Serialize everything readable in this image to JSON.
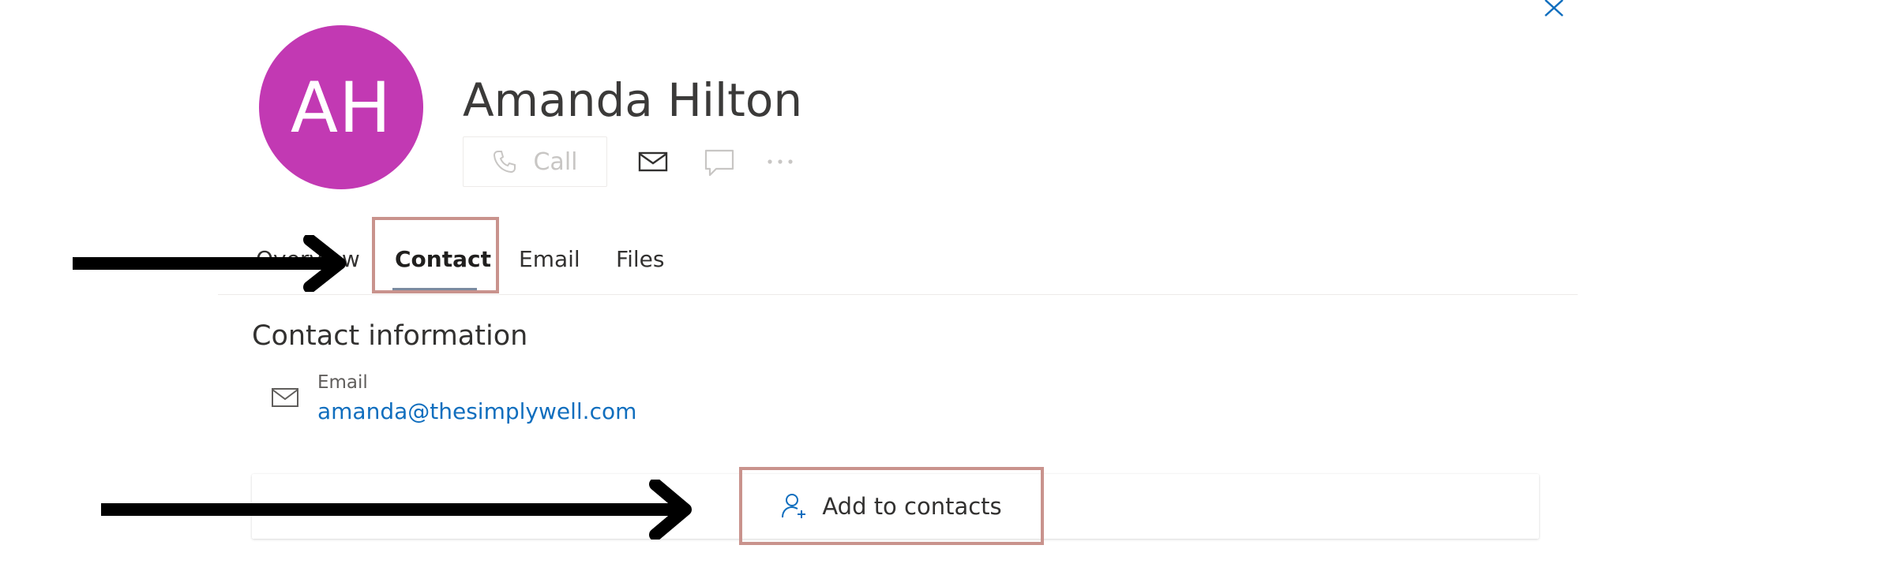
{
  "profile": {
    "initials": "AH",
    "name": "Amanda Hilton",
    "avatar_color": "#c239b3"
  },
  "actions": {
    "call_label": "Call",
    "call_icon": "phone-icon",
    "mail_icon": "mail-icon",
    "chat_icon": "chat-icon",
    "more_icon": "more-icon"
  },
  "tabs": [
    {
      "label": "Overview",
      "selected": false
    },
    {
      "label": "Contact",
      "selected": true
    },
    {
      "label": "Email",
      "selected": false
    },
    {
      "label": "Files",
      "selected": false
    }
  ],
  "contact_info": {
    "title": "Contact information",
    "email_label": "Email",
    "email_value": "amanda@thesimplywell.com"
  },
  "add_contact": {
    "label": "Add to contacts",
    "icon": "person-add-icon"
  },
  "colors": {
    "link": "#106ebe",
    "highlight_box": "#c9938d",
    "close_icon": "#106ebe"
  }
}
